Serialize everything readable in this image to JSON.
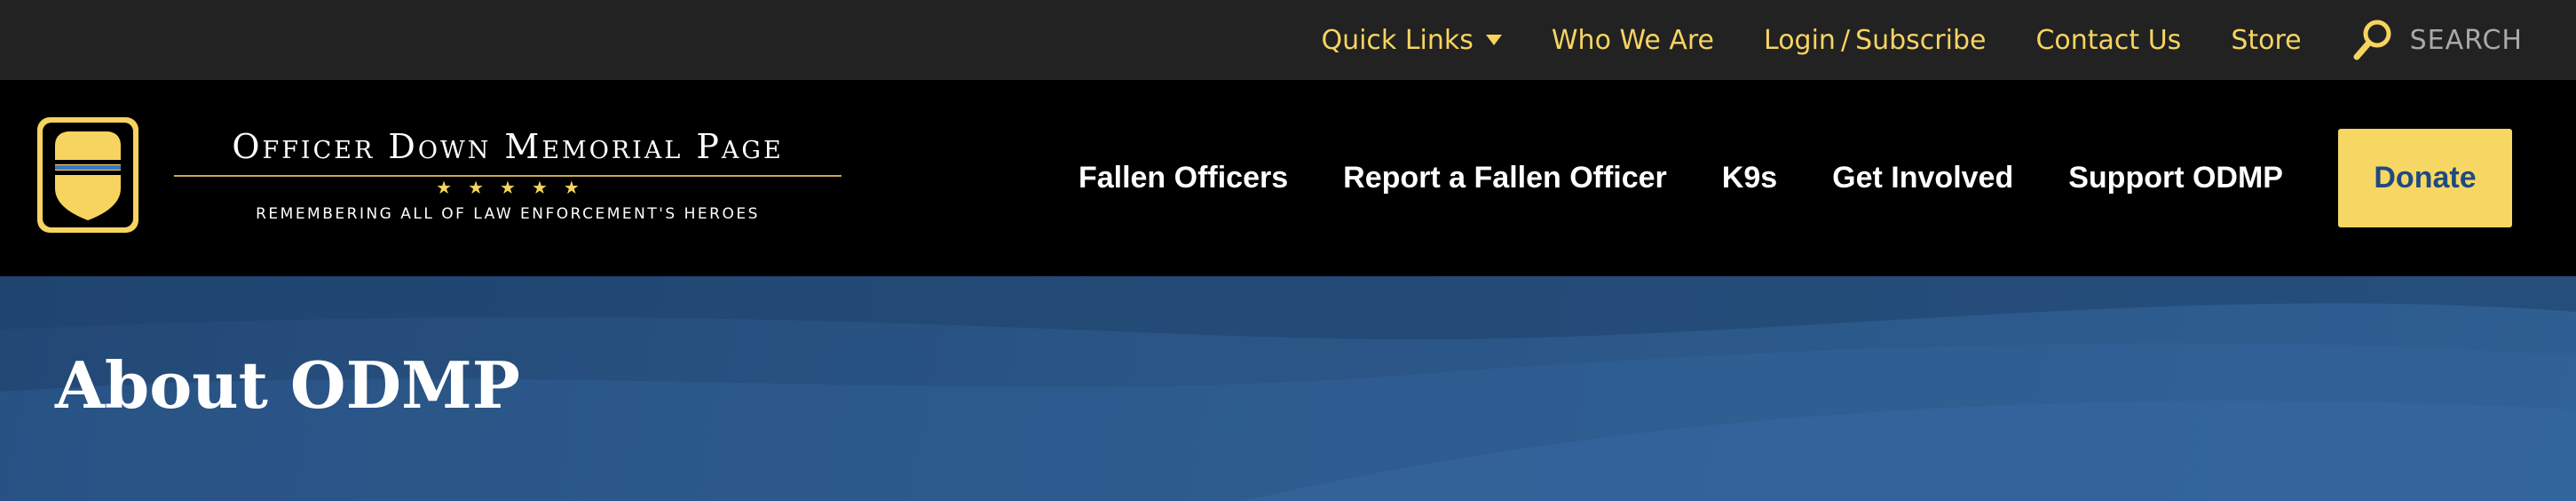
{
  "utility_nav": {
    "quick_links": "Quick Links",
    "who_we_are": "Who We Are",
    "login": "Login",
    "slash": "/",
    "subscribe": "Subscribe",
    "contact_us": "Contact Us",
    "store": "Store",
    "search_label": "SEARCH",
    "search_icon": "search-icon"
  },
  "logo": {
    "title": "Officer Down Memorial Page",
    "stars": [
      "★",
      "★",
      "★",
      "★",
      "★"
    ],
    "tagline": "REMEMBERING ALL OF LAW ENFORCEMENT'S HEROES"
  },
  "main_nav": {
    "items": [
      "Fallen Officers",
      "Report a Fallen Officer",
      "K9s",
      "Get Involved",
      "Support ODMP"
    ],
    "donate": "Donate"
  },
  "hero": {
    "title": "About ODMP"
  },
  "colors": {
    "utility_bg": "#222222",
    "header_bg": "#000000",
    "accent_gold": "#f7d460",
    "donate_text": "#1f4a80",
    "hero_blue": "#2a5585"
  }
}
